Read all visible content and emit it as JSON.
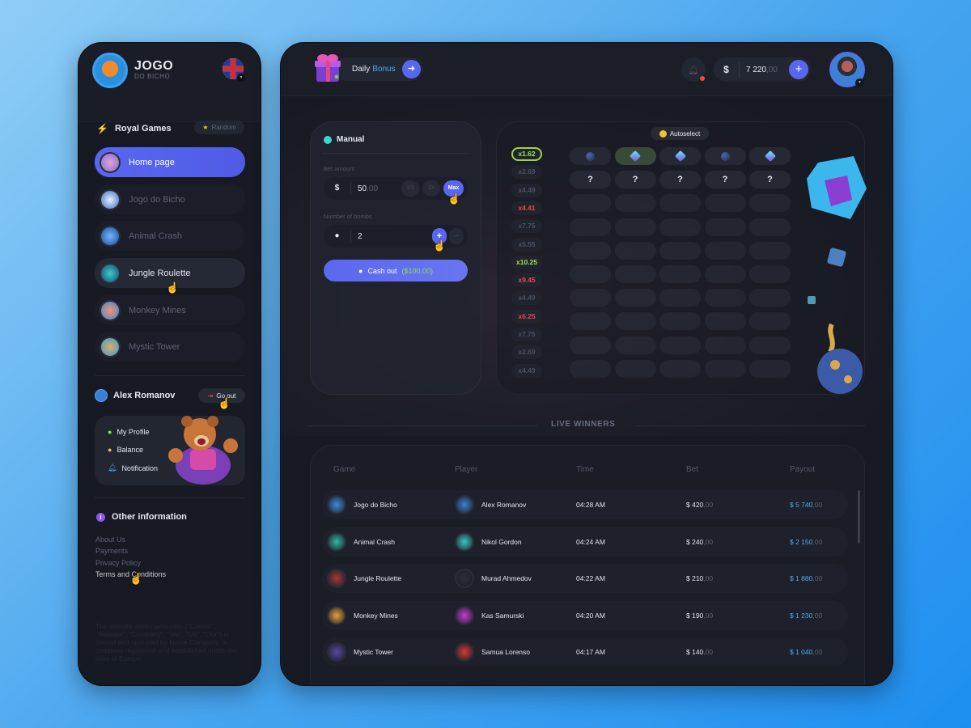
{
  "sidebar": {
    "brand": {
      "title": "JOGO",
      "subtitle": "DO BICHO"
    },
    "language": "en-GB",
    "section_title": "Royal Games",
    "random_label": "Random",
    "nav": [
      {
        "label": "Home page",
        "state": "active"
      },
      {
        "label": "Jogo do Bicho",
        "state": "default"
      },
      {
        "label": "Animal Crash",
        "state": "default"
      },
      {
        "label": "Jungle Roulette",
        "state": "hover"
      },
      {
        "label": "Monkey Mines",
        "state": "default"
      },
      {
        "label": "Mystic Tower",
        "state": "default"
      }
    ],
    "user": {
      "name": "Alex Romanov",
      "logout_label": "Go out"
    },
    "profile_menu": [
      {
        "label": "My Profile",
        "icon": "user-icon"
      },
      {
        "label": "Balance",
        "icon": "coins-icon"
      },
      {
        "label": "Notification",
        "icon": "bell-icon"
      }
    ],
    "other_title": "Other information",
    "links": [
      "About Us",
      "Payments",
      "Privacy Policy",
      "Terms and Conditions"
    ],
    "legal": "The website www.name.com (\"Casino\", \"Website\", \"Company\", \"We\", \"Us\", \"Our\") is owned and operated by Name Company, a company registered and established under the laws of Europe."
  },
  "header": {
    "daily": "Daily",
    "bonus": "Bonus",
    "currency": "$",
    "balance_int": "7 220",
    "balance_dec": ",00"
  },
  "game": {
    "mode": "Manual",
    "bet_label": "Bet amount",
    "bet_int": "50",
    "bet_dec": ",00",
    "half": "1/2",
    "double": "2x",
    "max": "Max",
    "bombs_label": "Number of bombs",
    "bombs": "2",
    "cashout_label": "Cash out",
    "cashout_amount": "($100,00)",
    "autoselect": "Autoselect",
    "multipliers": [
      {
        "v": "x1.62",
        "c": "sel"
      },
      {
        "v": "x2.69",
        "c": ""
      },
      {
        "v": "x4.49",
        "c": ""
      },
      {
        "v": "x4.41",
        "c": "red"
      },
      {
        "v": "x7.75",
        "c": ""
      },
      {
        "v": "x5.55",
        "c": ""
      },
      {
        "v": "x10.25",
        "c": "green"
      },
      {
        "v": "x9.45",
        "c": "red"
      },
      {
        "v": "x4.49",
        "c": ""
      },
      {
        "v": "x6.25",
        "c": "red"
      },
      {
        "v": "x7.75",
        "c": ""
      },
      {
        "v": "x2.69",
        "c": ""
      },
      {
        "v": "x4.49",
        "c": ""
      }
    ],
    "revealed_row": [
      "bomb",
      "gem",
      "gem",
      "bomb",
      "gem"
    ],
    "unknown_mark": "?"
  },
  "live_winners": {
    "title": "LIVE WINNERS",
    "columns": [
      "Game",
      "Player",
      "Time",
      "Bet",
      "Payout"
    ],
    "rows": [
      {
        "game": "Jogo do Bicho",
        "player": "Alex Romanov",
        "time": "04:28 AM",
        "bet": "$ 420",
        "payout": "$ 5 740"
      },
      {
        "game": "Animal Crash",
        "player": "Nikol Gordon",
        "time": "04:24 AM",
        "bet": "$ 240",
        "payout": "$ 2 150"
      },
      {
        "game": "Jungle Roulette",
        "player": "Murad Ahmedov",
        "time": "04:22 AM",
        "bet": "$ 210",
        "payout": "$ 1 880"
      },
      {
        "game": "Monkey Mines",
        "player": "Kas Samurski",
        "time": "04:20 AM",
        "bet": "$ 190",
        "payout": "$ 1 230"
      },
      {
        "game": "Mystic Tower",
        "player": "Samua Lorenso",
        "time": "04:17 AM",
        "bet": "$ 140",
        "payout": "$ 1 040"
      }
    ],
    "decimal": ",00"
  },
  "colors": {
    "accent": "#5967f0",
    "payout": "#4fa9ef",
    "win": "#a3e04b",
    "loss": "#ea4a4a"
  }
}
